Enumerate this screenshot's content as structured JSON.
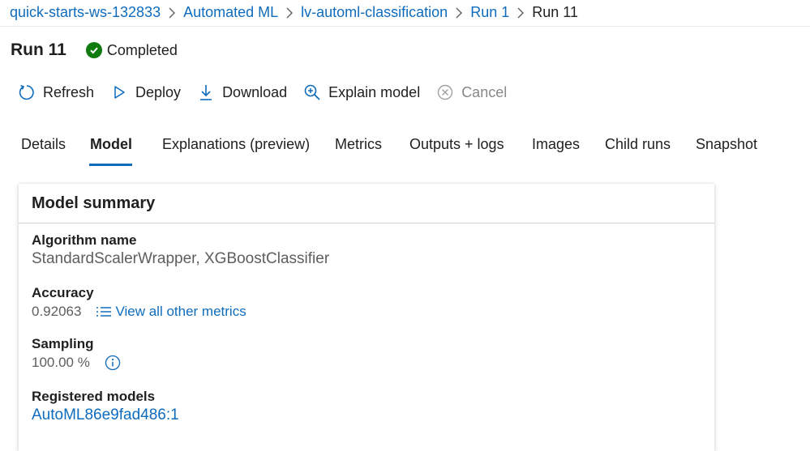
{
  "breadcrumb": {
    "items": [
      "quick-starts-ws-132833",
      "Automated ML",
      "lv-automl-classification",
      "Run 1"
    ],
    "current": "Run 11"
  },
  "run": {
    "title": "Run 11",
    "status": "Completed",
    "status_color": "#107c10"
  },
  "toolbar": {
    "refresh": "Refresh",
    "deploy": "Deploy",
    "download": "Download",
    "explain": "Explain model",
    "cancel": "Cancel"
  },
  "tabs": [
    "Details",
    "Model",
    "Explanations (preview)",
    "Metrics",
    "Outputs + logs",
    "Images",
    "Child runs",
    "Snapshot"
  ],
  "active_tab": "Model",
  "model_summary": {
    "title": "Model summary",
    "algorithm_label": "Algorithm name",
    "algorithm_value": "StandardScalerWrapper, XGBoostClassifier",
    "accuracy_label": "Accuracy",
    "accuracy_value": "0.92063",
    "view_metrics": "View all other metrics",
    "sampling_label": "Sampling",
    "sampling_value": "100.00 %",
    "registered_label": "Registered models",
    "registered_value": "AutoML86e9fad486:1"
  },
  "colors": {
    "link": "#0f6cbd",
    "accent": "#0f6cbd",
    "muted": "#605e5c",
    "disabled": "#8a8886"
  },
  "icons": {
    "refresh": "refresh-icon",
    "deploy": "play-outline-icon",
    "download": "download-icon",
    "explain": "zoom-in-icon",
    "cancel": "cancel-circle-icon",
    "status": "check-circle-icon",
    "metrics": "list-icon",
    "info": "info-icon",
    "separator": "chevron-right-icon"
  }
}
